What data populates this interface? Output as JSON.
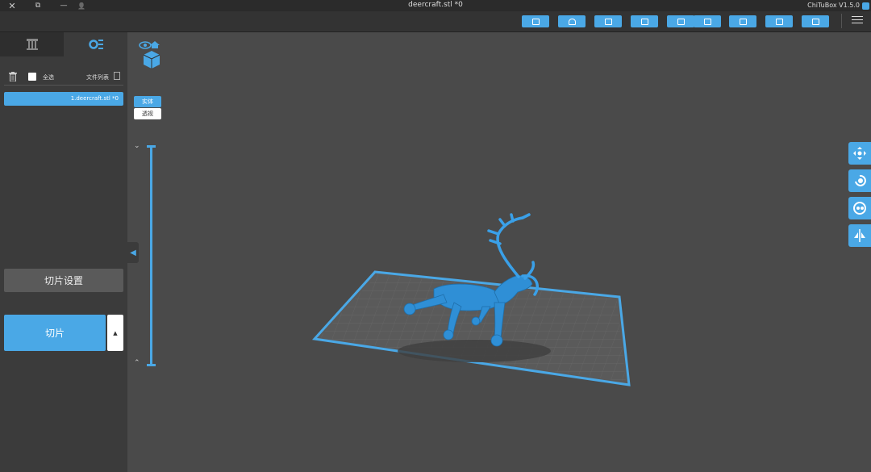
{
  "titlebar": {
    "title": "deercraft.stl *0",
    "app_name": "ChiTuBox V1.5.0",
    "close_glyph": "✕",
    "restore_glyph": "⧉",
    "minimize_glyph": "—",
    "user_glyph": "👤"
  },
  "toolbar": {
    "buttons": [
      "open-project",
      "save-project",
      "open-file",
      "export",
      "import",
      "repair",
      "layout",
      "support",
      "print-settings"
    ],
    "accent": "#4aa8e6"
  },
  "left_panel": {
    "file_list_label": "文件列表",
    "select_all_label": "全选",
    "file_item": "1.deercraft.stl *0",
    "slice_settings_label": "切片设置",
    "slice_label": "切片",
    "dropdown_glyph": "▲"
  },
  "viewport": {
    "solid_label": "实体",
    "transparent_label": "透视",
    "slider_top_glyph": "⌄",
    "slider_bottom_glyph": "⌃",
    "collapse_glyph": "◀"
  },
  "right_tools": [
    "move-icon",
    "rotate-icon",
    "scale-icon",
    "mirror-icon"
  ],
  "colors": {
    "accent": "#4aa8e6",
    "background": "#4a4a4a",
    "panel": "#3b3b3b",
    "model": "#2f8fd6"
  }
}
